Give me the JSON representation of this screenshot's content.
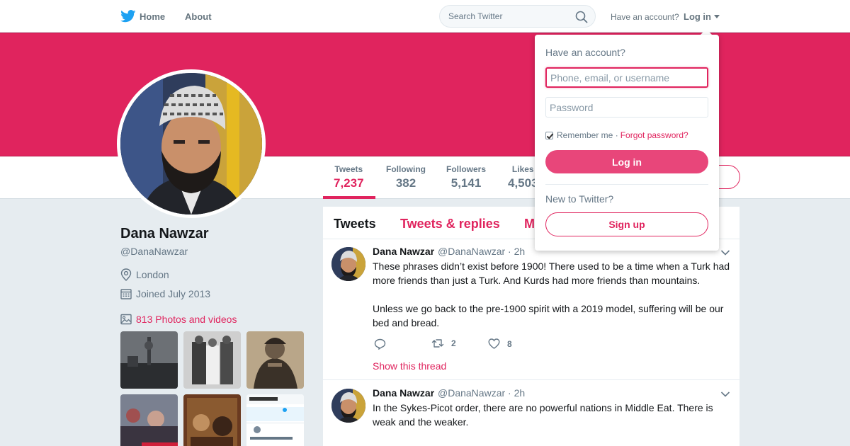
{
  "nav": {
    "home_label": "Home",
    "about_label": "About",
    "search_placeholder": "Search Twitter",
    "have_account": "Have an account?",
    "login_label": "Log in"
  },
  "colors": {
    "accent": "#e0245e",
    "twitter_blue": "#1da1f2"
  },
  "profile": {
    "name": "Dana Nawzar",
    "handle": "@DanaNawzar",
    "location": "London",
    "joined": "Joined July 2013",
    "photos_label": "813 Photos and videos"
  },
  "stats": [
    {
      "label": "Tweets",
      "value": "7,237"
    },
    {
      "label": "Following",
      "value": "382"
    },
    {
      "label": "Followers",
      "value": "5,141"
    },
    {
      "label": "Likes",
      "value": "4,503"
    }
  ],
  "timeline_tabs": [
    "Tweets",
    "Tweets & replies",
    "Media"
  ],
  "tweets": [
    {
      "name": "Dana Nawzar",
      "handle": "@DanaNawzar · 2h",
      "text": "These phrases didn’t exist before 1900! There used to be a time when a Turk had more friends than just a Turk. And Kurds had more friends than mountains.\n\nUnless we go back to the pre-1900 spirit with a 2019 model, suffering will be our bed and bread.",
      "retweets": "2",
      "likes": "8",
      "show_thread": "Show this thread"
    },
    {
      "name": "Dana Nawzar",
      "handle": "@DanaNawzar · 2h",
      "text": "In the Sykes-Picot order, there are no powerful nations in Middle Eat. There is weak and the weaker."
    }
  ],
  "login_dropdown": {
    "title": "Have an account?",
    "username_placeholder": "Phone, email, or username",
    "password_placeholder": "Password",
    "remember_me": "Remember me ·",
    "forgot_password": "Forgot password?",
    "login_button": "Log in",
    "new_to_twitter": "New to Twitter?",
    "signup_button": "Sign up"
  }
}
